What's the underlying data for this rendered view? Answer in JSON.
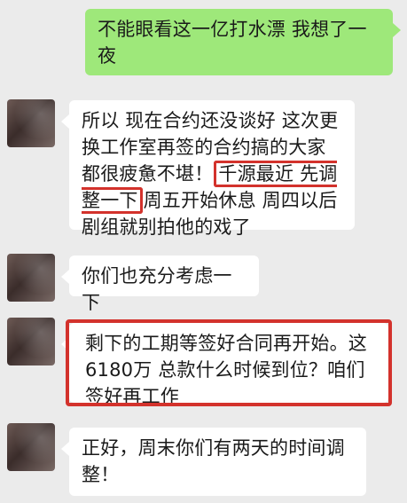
{
  "messages": [
    {
      "sender": "self",
      "text": "不能眼看这一亿打水漂 我想了一夜"
    },
    {
      "sender": "other",
      "text_before": "所以 现在合约还没谈好 这次更换工作室再签的合约搞的大家都很疲惫不堪！",
      "highlighted": "千源最近 先调整一下",
      "text_after": "周五开始休息 周四以后剧组就别拍他的戏了"
    },
    {
      "sender": "other",
      "text": "你们也充分考虑一下"
    },
    {
      "sender": "other",
      "text": "剩下的工期等签好合同再开始。这6180万 总款什么时候到位？咱们签好再工作",
      "highlighted": true
    },
    {
      "sender": "other",
      "text": "正好，周末你们有两天的时间调整！"
    }
  ],
  "colors": {
    "background": "#ebebeb",
    "outgoing_bubble": "#9ee87a",
    "incoming_bubble": "#ffffff",
    "highlight": "#d3322c"
  },
  "icons": {
    "avatar": "contact-avatar"
  }
}
